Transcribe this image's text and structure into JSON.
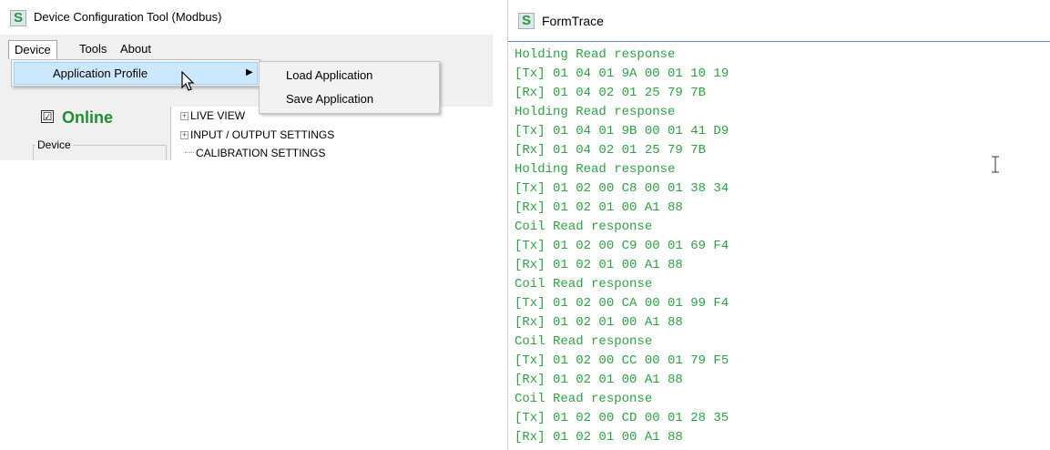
{
  "left_window": {
    "title": "Device Configuration Tool (Modbus)",
    "menu": {
      "device": "Device",
      "tools": "Tools",
      "about": "About"
    },
    "submenu": {
      "application_profile": "Application Profile"
    },
    "flyout": {
      "load": "Load Application",
      "save": "Save Application"
    },
    "online": {
      "checked": true,
      "check_glyph": "☑",
      "label": "Online"
    },
    "device_group_label": "Device",
    "tree": [
      {
        "label": "LIVE VIEW",
        "expandable": true
      },
      {
        "label": "INPUT / OUTPUT SETTINGS",
        "expandable": true
      },
      {
        "label": "CALIBRATION SETTINGS",
        "expandable": false
      }
    ]
  },
  "right_window": {
    "title": "FormTrace",
    "trace_color": "#2fa045",
    "lines": [
      "Holding Read response",
      "[Tx] 01 04 01 9A 00 01 10 19",
      "[Rx] 01 04 02 01 25 79 7B",
      "Holding Read response",
      "[Tx] 01 04 01 9B 00 01 41 D9",
      "[Rx] 01 04 02 01 25 79 7B",
      "Holding Read response",
      "[Tx] 01 02 00 C8 00 01 38 34",
      "[Rx] 01 02 01 00 A1 88",
      "Coil Read response",
      "[Tx] 01 02 00 C9 00 01 69 F4",
      "[Rx] 01 02 01 00 A1 88",
      "Coil Read response",
      "[Tx] 01 02 00 CA 00 01 99 F4",
      "[Rx] 01 02 01 00 A1 88",
      "Coil Read response",
      "[Tx] 01 02 00 CC 00 01 79 F5",
      "[Rx] 01 02 01 00 A1 88",
      "Coil Read response",
      "[Tx] 01 02 00 CD 00 01 28 35",
      "[Rx] 01 02 01 00 A1 88"
    ]
  },
  "app_icon_letter": "S"
}
